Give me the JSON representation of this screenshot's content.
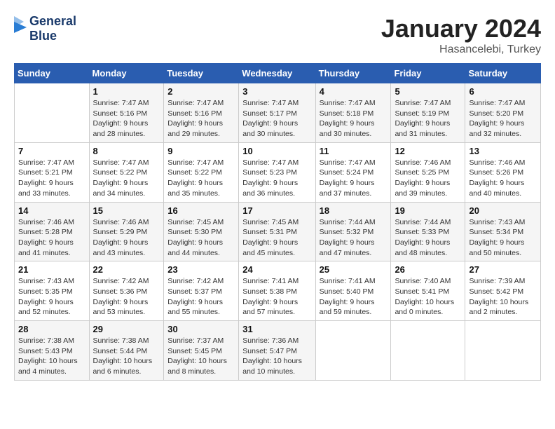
{
  "header": {
    "logo_line1": "General",
    "logo_line2": "Blue",
    "month": "January 2024",
    "location": "Hasancelebi, Turkey"
  },
  "weekdays": [
    "Sunday",
    "Monday",
    "Tuesday",
    "Wednesday",
    "Thursday",
    "Friday",
    "Saturday"
  ],
  "weeks": [
    [
      {
        "day": "",
        "sunrise": "",
        "sunset": "",
        "daylight": ""
      },
      {
        "day": "1",
        "sunrise": "Sunrise: 7:47 AM",
        "sunset": "Sunset: 5:16 PM",
        "daylight": "Daylight: 9 hours and 28 minutes."
      },
      {
        "day": "2",
        "sunrise": "Sunrise: 7:47 AM",
        "sunset": "Sunset: 5:16 PM",
        "daylight": "Daylight: 9 hours and 29 minutes."
      },
      {
        "day": "3",
        "sunrise": "Sunrise: 7:47 AM",
        "sunset": "Sunset: 5:17 PM",
        "daylight": "Daylight: 9 hours and 30 minutes."
      },
      {
        "day": "4",
        "sunrise": "Sunrise: 7:47 AM",
        "sunset": "Sunset: 5:18 PM",
        "daylight": "Daylight: 9 hours and 30 minutes."
      },
      {
        "day": "5",
        "sunrise": "Sunrise: 7:47 AM",
        "sunset": "Sunset: 5:19 PM",
        "daylight": "Daylight: 9 hours and 31 minutes."
      },
      {
        "day": "6",
        "sunrise": "Sunrise: 7:47 AM",
        "sunset": "Sunset: 5:20 PM",
        "daylight": "Daylight: 9 hours and 32 minutes."
      }
    ],
    [
      {
        "day": "7",
        "sunrise": "Sunrise: 7:47 AM",
        "sunset": "Sunset: 5:21 PM",
        "daylight": "Daylight: 9 hours and 33 minutes."
      },
      {
        "day": "8",
        "sunrise": "Sunrise: 7:47 AM",
        "sunset": "Sunset: 5:22 PM",
        "daylight": "Daylight: 9 hours and 34 minutes."
      },
      {
        "day": "9",
        "sunrise": "Sunrise: 7:47 AM",
        "sunset": "Sunset: 5:22 PM",
        "daylight": "Daylight: 9 hours and 35 minutes."
      },
      {
        "day": "10",
        "sunrise": "Sunrise: 7:47 AM",
        "sunset": "Sunset: 5:23 PM",
        "daylight": "Daylight: 9 hours and 36 minutes."
      },
      {
        "day": "11",
        "sunrise": "Sunrise: 7:47 AM",
        "sunset": "Sunset: 5:24 PM",
        "daylight": "Daylight: 9 hours and 37 minutes."
      },
      {
        "day": "12",
        "sunrise": "Sunrise: 7:46 AM",
        "sunset": "Sunset: 5:25 PM",
        "daylight": "Daylight: 9 hours and 39 minutes."
      },
      {
        "day": "13",
        "sunrise": "Sunrise: 7:46 AM",
        "sunset": "Sunset: 5:26 PM",
        "daylight": "Daylight: 9 hours and 40 minutes."
      }
    ],
    [
      {
        "day": "14",
        "sunrise": "Sunrise: 7:46 AM",
        "sunset": "Sunset: 5:28 PM",
        "daylight": "Daylight: 9 hours and 41 minutes."
      },
      {
        "day": "15",
        "sunrise": "Sunrise: 7:46 AM",
        "sunset": "Sunset: 5:29 PM",
        "daylight": "Daylight: 9 hours and 43 minutes."
      },
      {
        "day": "16",
        "sunrise": "Sunrise: 7:45 AM",
        "sunset": "Sunset: 5:30 PM",
        "daylight": "Daylight: 9 hours and 44 minutes."
      },
      {
        "day": "17",
        "sunrise": "Sunrise: 7:45 AM",
        "sunset": "Sunset: 5:31 PM",
        "daylight": "Daylight: 9 hours and 45 minutes."
      },
      {
        "day": "18",
        "sunrise": "Sunrise: 7:44 AM",
        "sunset": "Sunset: 5:32 PM",
        "daylight": "Daylight: 9 hours and 47 minutes."
      },
      {
        "day": "19",
        "sunrise": "Sunrise: 7:44 AM",
        "sunset": "Sunset: 5:33 PM",
        "daylight": "Daylight: 9 hours and 48 minutes."
      },
      {
        "day": "20",
        "sunrise": "Sunrise: 7:43 AM",
        "sunset": "Sunset: 5:34 PM",
        "daylight": "Daylight: 9 hours and 50 minutes."
      }
    ],
    [
      {
        "day": "21",
        "sunrise": "Sunrise: 7:43 AM",
        "sunset": "Sunset: 5:35 PM",
        "daylight": "Daylight: 9 hours and 52 minutes."
      },
      {
        "day": "22",
        "sunrise": "Sunrise: 7:42 AM",
        "sunset": "Sunset: 5:36 PM",
        "daylight": "Daylight: 9 hours and 53 minutes."
      },
      {
        "day": "23",
        "sunrise": "Sunrise: 7:42 AM",
        "sunset": "Sunset: 5:37 PM",
        "daylight": "Daylight: 9 hours and 55 minutes."
      },
      {
        "day": "24",
        "sunrise": "Sunrise: 7:41 AM",
        "sunset": "Sunset: 5:38 PM",
        "daylight": "Daylight: 9 hours and 57 minutes."
      },
      {
        "day": "25",
        "sunrise": "Sunrise: 7:41 AM",
        "sunset": "Sunset: 5:40 PM",
        "daylight": "Daylight: 9 hours and 59 minutes."
      },
      {
        "day": "26",
        "sunrise": "Sunrise: 7:40 AM",
        "sunset": "Sunset: 5:41 PM",
        "daylight": "Daylight: 10 hours and 0 minutes."
      },
      {
        "day": "27",
        "sunrise": "Sunrise: 7:39 AM",
        "sunset": "Sunset: 5:42 PM",
        "daylight": "Daylight: 10 hours and 2 minutes."
      }
    ],
    [
      {
        "day": "28",
        "sunrise": "Sunrise: 7:38 AM",
        "sunset": "Sunset: 5:43 PM",
        "daylight": "Daylight: 10 hours and 4 minutes."
      },
      {
        "day": "29",
        "sunrise": "Sunrise: 7:38 AM",
        "sunset": "Sunset: 5:44 PM",
        "daylight": "Daylight: 10 hours and 6 minutes."
      },
      {
        "day": "30",
        "sunrise": "Sunrise: 7:37 AM",
        "sunset": "Sunset: 5:45 PM",
        "daylight": "Daylight: 10 hours and 8 minutes."
      },
      {
        "day": "31",
        "sunrise": "Sunrise: 7:36 AM",
        "sunset": "Sunset: 5:47 PM",
        "daylight": "Daylight: 10 hours and 10 minutes."
      },
      {
        "day": "",
        "sunrise": "",
        "sunset": "",
        "daylight": ""
      },
      {
        "day": "",
        "sunrise": "",
        "sunset": "",
        "daylight": ""
      },
      {
        "day": "",
        "sunrise": "",
        "sunset": "",
        "daylight": ""
      }
    ]
  ]
}
